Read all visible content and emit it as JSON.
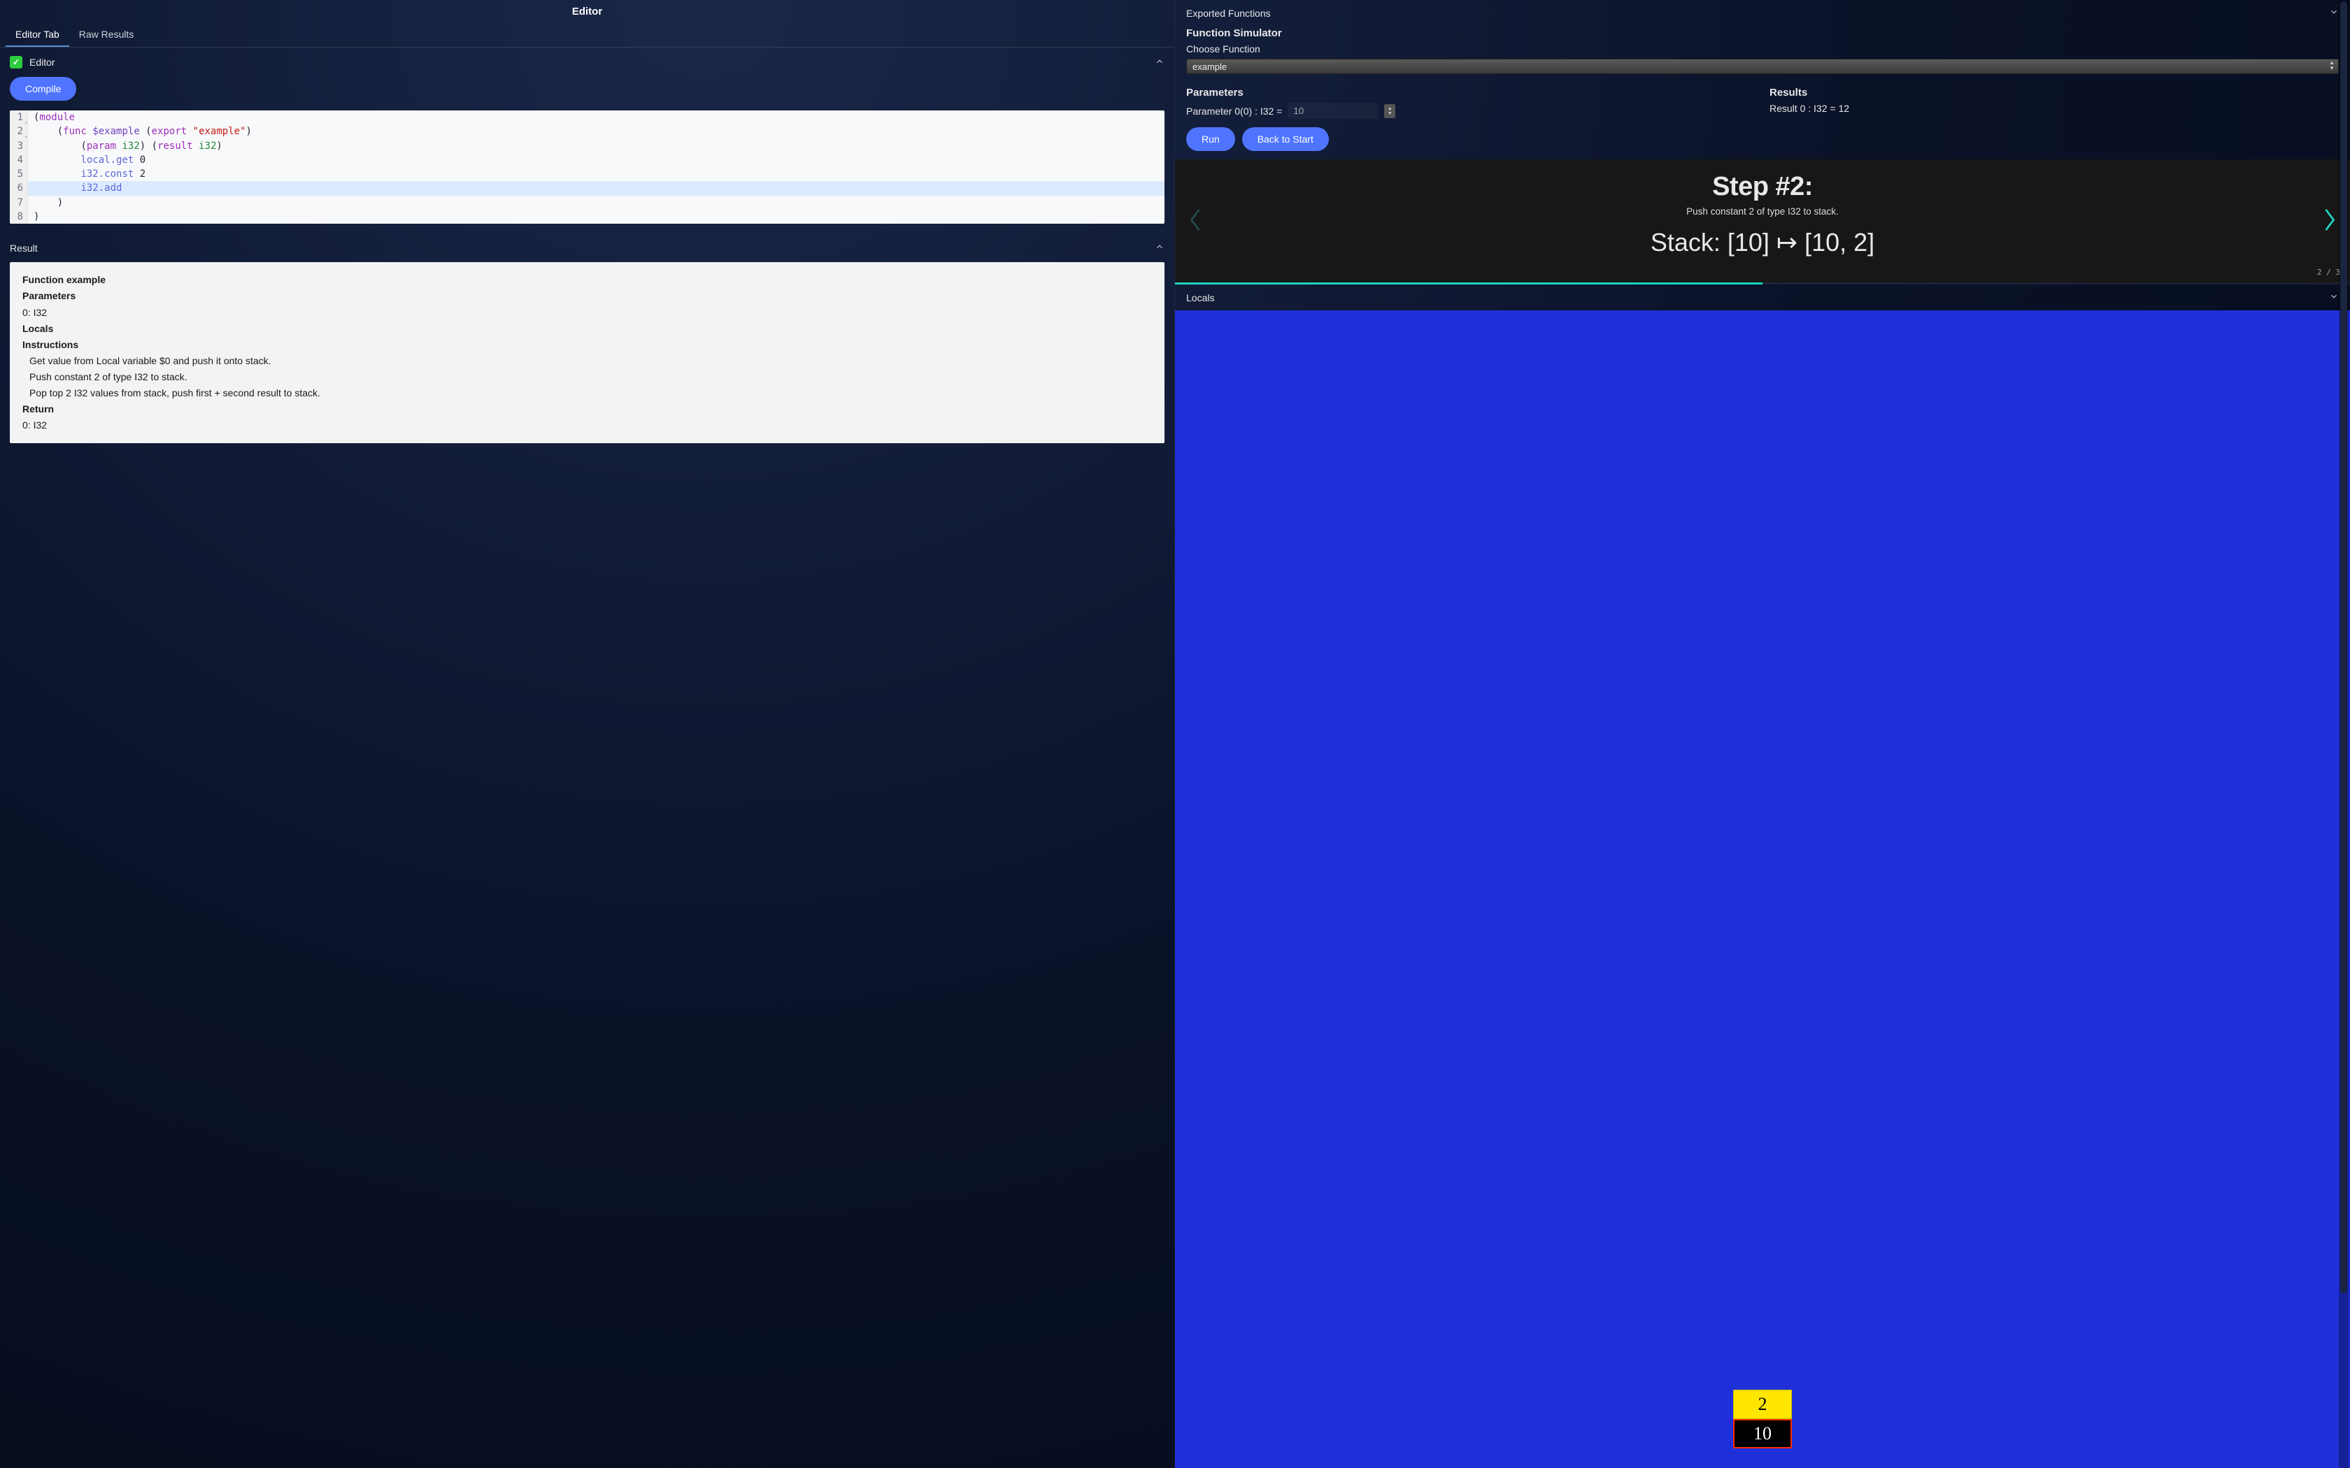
{
  "left": {
    "title": "Editor",
    "tabs": {
      "editor": "Editor Tab",
      "raw": "Raw Results"
    },
    "editor_header": "Editor",
    "compile": "Compile",
    "code": {
      "l1_kw": "module",
      "l2_func": "func",
      "l2_var": "$example",
      "l2_export": "export",
      "l2_str": "\"example\"",
      "l3_param": "param",
      "l3_type1": "i32",
      "l3_result": "result",
      "l3_type2": "i32",
      "l4": "local.get",
      "l4_arg": "0",
      "l5": "i32.const",
      "l5_arg": "2",
      "l6": "i32.add"
    },
    "result_header": "Result",
    "result": {
      "fn": "Function example",
      "params_h": "Parameters",
      "param0": "0: I32",
      "locals_h": "Locals",
      "instr_h": "Instructions",
      "i1": "Get value from Local variable $0 and push it onto stack.",
      "i2": "Push constant 2 of type I32 to stack.",
      "i3": "Pop top 2 I32 values from stack, push first + second result to stack.",
      "return_h": "Return",
      "return0": "0: I32"
    }
  },
  "right": {
    "exported": "Exported Functions",
    "sim_title": "Function Simulator",
    "choose": "Choose Function",
    "selected_fn": "example",
    "params_h": "Parameters",
    "param_label": "Parameter 0(0) : I32 = ",
    "param_value": "10",
    "results_h": "Results",
    "result_line": "Result 0 : I32 = 12",
    "run": "Run",
    "back": "Back to Start",
    "step_title": "Step #2:",
    "step_desc": "Push constant 2 of type I32 to stack.",
    "stack_line": "Stack: [10] ↦ [10, 2]",
    "counter": "2 / 3",
    "locals": "Locals",
    "stack_top": "2",
    "stack_bottom": "10"
  }
}
